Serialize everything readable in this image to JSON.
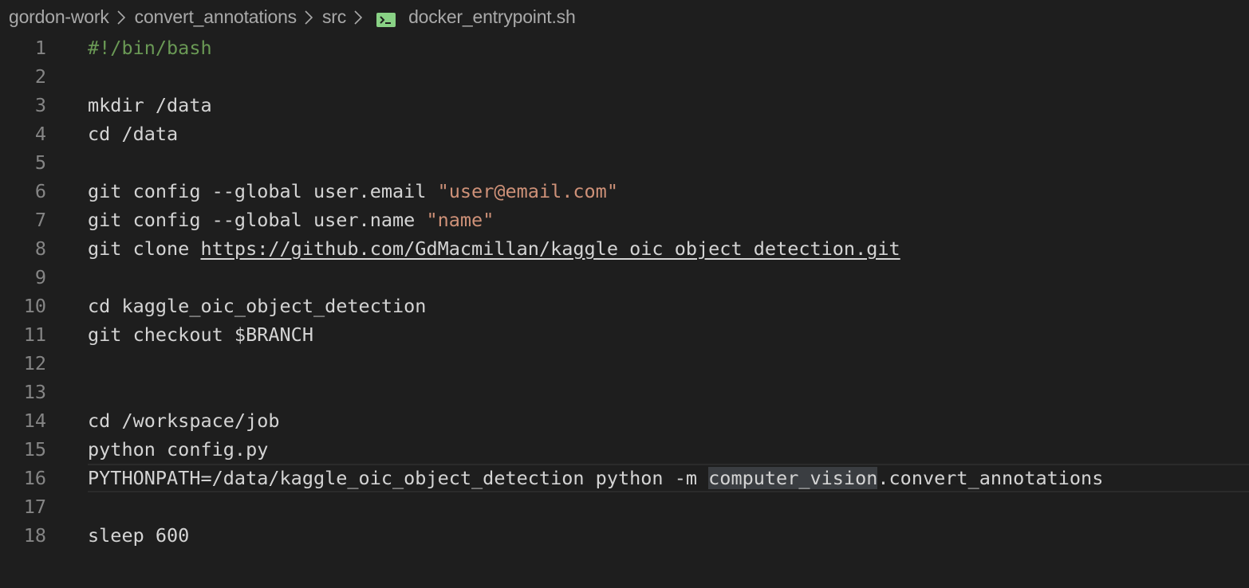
{
  "breadcrumb": {
    "items": [
      "gordon-work",
      "convert_annotations",
      "src"
    ],
    "file": "docker_entrypoint.sh",
    "file_icon": "terminal-icon"
  },
  "editor": {
    "current_line": 16,
    "lines": [
      {
        "number": "1",
        "tokens": [
          {
            "text": "#!/bin/bash",
            "type": "comment"
          }
        ]
      },
      {
        "number": "2",
        "tokens": []
      },
      {
        "number": "3",
        "tokens": [
          {
            "text": "mkdir /data",
            "type": "plain"
          }
        ]
      },
      {
        "number": "4",
        "tokens": [
          {
            "text": "cd /data",
            "type": "plain"
          }
        ]
      },
      {
        "number": "5",
        "tokens": []
      },
      {
        "number": "6",
        "tokens": [
          {
            "text": "git config --global user.email ",
            "type": "plain"
          },
          {
            "text": "\"user@email.com\"",
            "type": "string"
          }
        ]
      },
      {
        "number": "7",
        "tokens": [
          {
            "text": "git config --global user.name ",
            "type": "plain"
          },
          {
            "text": "\"name\"",
            "type": "string"
          }
        ]
      },
      {
        "number": "8",
        "tokens": [
          {
            "text": "git clone ",
            "type": "plain"
          },
          {
            "text": "https://github.com/GdMacmillan/kaggle_oic_object_detection.git",
            "type": "link"
          }
        ]
      },
      {
        "number": "9",
        "tokens": []
      },
      {
        "number": "10",
        "tokens": [
          {
            "text": "cd kaggle_oic_object_detection",
            "type": "plain"
          }
        ]
      },
      {
        "number": "11",
        "tokens": [
          {
            "text": "git checkout $BRANCH",
            "type": "plain"
          }
        ]
      },
      {
        "number": "12",
        "tokens": []
      },
      {
        "number": "13",
        "tokens": []
      },
      {
        "number": "14",
        "tokens": [
          {
            "text": "cd /workspace/job",
            "type": "plain"
          }
        ]
      },
      {
        "number": "15",
        "tokens": [
          {
            "text": "python config.py",
            "type": "plain"
          }
        ]
      },
      {
        "number": "16",
        "tokens": [
          {
            "text": "PYTHONPATH=/data/kaggle_oic_object_detection python -m ",
            "type": "plain"
          },
          {
            "text": "computer_vision",
            "type": "highlight"
          },
          {
            "text": ".convert_annotations",
            "type": "plain"
          }
        ]
      },
      {
        "number": "17",
        "tokens": []
      },
      {
        "number": "18",
        "tokens": [
          {
            "text": "sleep 600",
            "type": "plain"
          }
        ]
      }
    ]
  }
}
